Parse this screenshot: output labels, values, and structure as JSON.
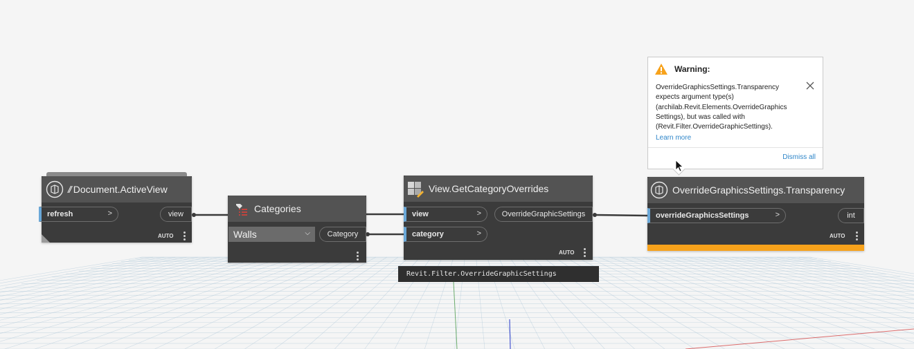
{
  "colors": {
    "canvas_bg": "#f5f5f5",
    "grid_line": "#a9c4d6",
    "node_header": "#535353",
    "node_body": "#3b3b3b",
    "input_port_accent": "#6aa8d8",
    "warning_bar": "#f7a21b",
    "link": "#2f86c9"
  },
  "nodes": {
    "document_active_view": {
      "title": "Document.ActiveView",
      "inputs": [
        {
          "label": "refresh",
          "arrow": ">"
        }
      ],
      "outputs": [
        {
          "label": "view"
        }
      ],
      "lacing": "AUTO",
      "icon": "document-active-view-icon"
    },
    "categories": {
      "title": "Categories",
      "dropdown_value": "Walls",
      "outputs": [
        {
          "label": "Category"
        }
      ],
      "icon": "categories-icon"
    },
    "view_get_category_overrides": {
      "title": "View.GetCategoryOverrides",
      "inputs": [
        {
          "label": "view",
          "arrow": ">"
        },
        {
          "label": "category",
          "arrow": ">"
        }
      ],
      "outputs": [
        {
          "label": "OverrideGraphicSettings"
        }
      ],
      "lacing": "AUTO",
      "icon": "view-category-icon"
    },
    "override_transparency": {
      "title": "OverrideGraphicsSettings.Transparency",
      "inputs": [
        {
          "label": "overrideGraphicsSettings",
          "arrow": ">"
        }
      ],
      "outputs": [
        {
          "label": "int"
        }
      ],
      "lacing": "AUTO",
      "icon": "override-graphics-icon"
    }
  },
  "tooltip": {
    "text": "Revit.Filter.OverrideGraphicSettings"
  },
  "warning": {
    "title": "Warning:",
    "message": "OverrideGraphicsSettings.Transparency expects argument type(s) (archilab.Revit.Elements.OverrideGraphics Settings), but was called with (Revit.Filter.OverrideGraphicSettings).",
    "learn_more": "Learn more",
    "dismiss_all": "Dismiss all",
    "icon": "warning-triangle-icon"
  }
}
